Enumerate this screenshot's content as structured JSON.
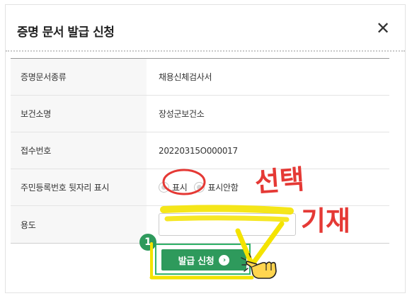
{
  "dialog": {
    "title": "증명 문서 발급 신청",
    "close_symbol": "✕"
  },
  "rows": [
    {
      "label": "증명문서종류",
      "value": "채용신체검사서"
    },
    {
      "label": "보건소명",
      "value": "장성군보건소"
    },
    {
      "label": "접수번호",
      "value": "20220315O000017"
    },
    {
      "label": "주민등록번호 뒷자리 표시"
    },
    {
      "label": "용도"
    }
  ],
  "radio_options": {
    "show": "표시",
    "hide": "표시안함"
  },
  "purpose_input": {
    "value": ""
  },
  "submit": {
    "label": "발급 신청",
    "arrow": "›",
    "step_number": "1"
  },
  "annotations": {
    "select_note": "선택",
    "write_note": "기재",
    "check_mark": "V"
  },
  "colors": {
    "accent_green": "#2e9a5c",
    "annotation_red": "#e53935",
    "highlight_yellow": "#f4e300"
  },
  "icons": {
    "close": "close-icon",
    "arrow": "chevron-right-circle-icon",
    "hand": "pointing-hand-icon"
  }
}
